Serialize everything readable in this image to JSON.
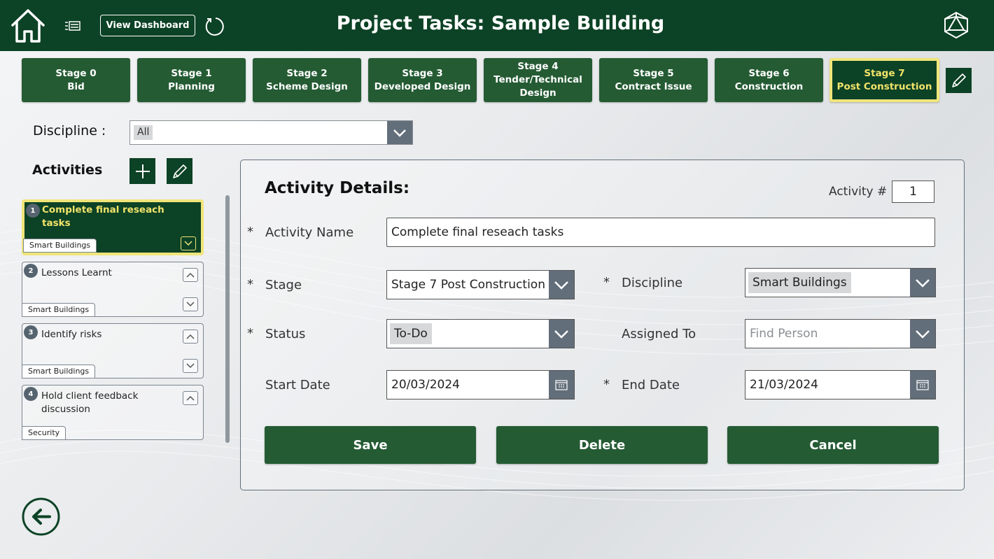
{
  "header": {
    "title": "Project Tasks: Sample Building",
    "view_dashboard_label": "View Dashboard"
  },
  "stages": [
    {
      "line1": "Stage 0",
      "line2": "Bid",
      "line3": ""
    },
    {
      "line1": "Stage 1",
      "line2": "Planning",
      "line3": ""
    },
    {
      "line1": "Stage 2",
      "line2": "Scheme Design",
      "line3": ""
    },
    {
      "line1": "Stage 3",
      "line2": "Developed Design",
      "line3": ""
    },
    {
      "line1": "Stage 4",
      "line2": "Tender/Technical",
      "line3": "Design"
    },
    {
      "line1": "Stage 5",
      "line2": "Contract Issue",
      "line3": ""
    },
    {
      "line1": "Stage 6",
      "line2": "Construction",
      "line3": ""
    },
    {
      "line1": "Stage 7",
      "line2": "Post Construction",
      "line3": ""
    }
  ],
  "filter": {
    "discipline_label": "Discipline :",
    "discipline_value": "All"
  },
  "activities": {
    "label": "Activities",
    "items": [
      {
        "num": "1",
        "title": "Complete final reseach tasks",
        "tag": "Smart Buildings"
      },
      {
        "num": "2",
        "title": "Lessons Learnt",
        "tag": "Smart Buildings"
      },
      {
        "num": "3",
        "title": "Identify risks",
        "tag": "Smart Buildings"
      },
      {
        "num": "4",
        "title": "Hold client feedback discussion",
        "tag": "Security"
      }
    ]
  },
  "details": {
    "title": "Activity Details:",
    "activity_no_label": "Activity #",
    "activity_no": "1",
    "required_mark": "*",
    "name_label": "Activity Name",
    "name_value": "Complete final reseach tasks",
    "stage_label": "Stage",
    "stage_value": "Stage 7 Post Construction",
    "discipline_label": "Discipline",
    "discipline_value": "Smart Buildings",
    "status_label": "Status",
    "status_value": "To-Do",
    "assigned_label": "Assigned To",
    "assigned_placeholder": "Find Person",
    "start_label": "Start Date",
    "start_value": "20/03/2024",
    "end_label": "End Date",
    "end_value": "21/03/2024"
  },
  "actions": {
    "save": "Save",
    "delete": "Delete",
    "cancel": "Cancel"
  },
  "colors": {
    "header_bg": "#0c4225",
    "button_green": "#245b33",
    "highlight_yellow": "#f0e57a",
    "chevron_grey": "#626e7a"
  }
}
